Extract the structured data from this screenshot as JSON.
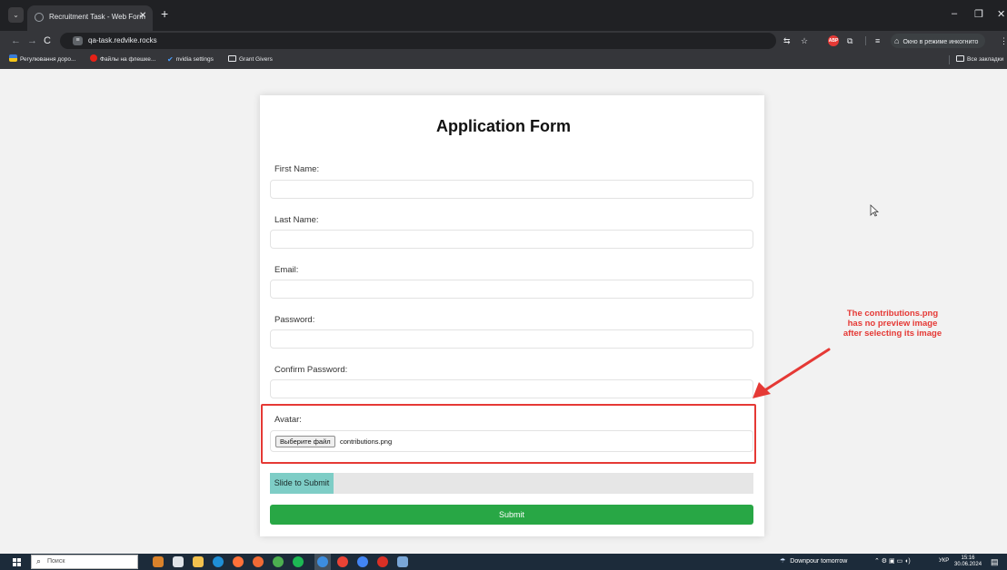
{
  "browser": {
    "tab_menu_glyph": "⌄",
    "tab_title": "Recruitment Task - Web Form",
    "tab_close": "✕",
    "new_tab": "+",
    "window": {
      "minimize": "–",
      "maximize": "❐",
      "close": "✕"
    },
    "nav": {
      "back": "←",
      "forward": "→",
      "reload": "C"
    },
    "url": "qa-task.redvike.rocks",
    "site_icon": "≡",
    "ext_badge": "ABP",
    "incognito_label": "Окно в режиме инкогнито",
    "icons": {
      "translate": "translate-icon",
      "bookmark_star": "star-icon",
      "extensions": "puzzle-icon",
      "tab_search": "tab-search-icon",
      "incognito": "incognito-icon",
      "menu": "kebab-menu-icon"
    }
  },
  "bookmarks": [
    {
      "label": "Регулювання доро..."
    },
    {
      "label": "Файлы на флешке..."
    },
    {
      "label": "nvidia settings"
    },
    {
      "label": "Grant Givers"
    }
  ],
  "all_bookmarks": "Все закладки",
  "form": {
    "title": "Application Form",
    "first_name_label": "First Name:",
    "last_name_label": "Last Name:",
    "email_label": "Email:",
    "password_label": "Password:",
    "confirm_password_label": "Confirm Password:",
    "avatar_label": "Avatar:",
    "file_button": "Выберите файл",
    "file_name": "contributions.png",
    "slider_label": "Slide to Submit",
    "slider_progress": 0,
    "submit_label": "Submit"
  },
  "annotation": {
    "text": "The contributions.png has no preview image after selecting its image",
    "color": "#e53935"
  },
  "taskbar": {
    "search_placeholder": "Поиск",
    "weather": "Downpour tomorrow",
    "language": "УКР",
    "time": "15:16",
    "date": "30.06.2024"
  },
  "colors": {
    "submit": "#28a745",
    "slider_handle": "#7ecdc6",
    "annotation": "#e53935"
  }
}
